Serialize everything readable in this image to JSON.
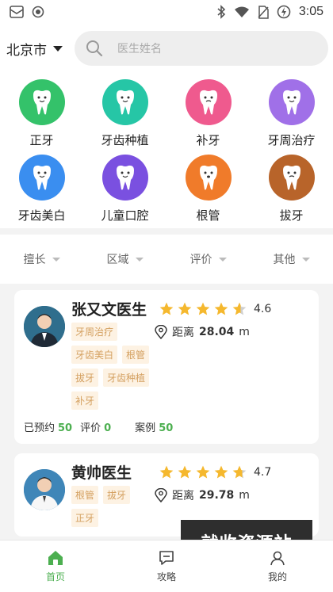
{
  "status_bar": {
    "time": "3:05"
  },
  "header": {
    "city": "北京市",
    "search_placeholder": "医生姓名"
  },
  "categories": [
    {
      "label": "正牙",
      "color": "#34c26a"
    },
    {
      "label": "牙齿种植",
      "color": "#26c6a6"
    },
    {
      "label": "补牙",
      "color": "#ef5a8e"
    },
    {
      "label": "牙周治疗",
      "color": "#a070e8"
    },
    {
      "label": "牙齿美白",
      "color": "#3a8ef0"
    },
    {
      "label": "儿童口腔",
      "color": "#7a50e0"
    },
    {
      "label": "根管",
      "color": "#f07b2a"
    },
    {
      "label": "拔牙",
      "color": "#b8642a"
    }
  ],
  "filters": [
    {
      "label": "擅长"
    },
    {
      "label": "区域"
    },
    {
      "label": "评价"
    },
    {
      "label": "其他"
    }
  ],
  "doctors": [
    {
      "name": "张又文医生",
      "rating": "4.6",
      "rating_value": 4.6,
      "distance_prefix": "距离",
      "distance": "28.04",
      "distance_unit": "m",
      "tags": [
        "牙周治疗",
        "牙齿美白",
        "根管",
        "拔牙",
        "牙齿种植",
        "补牙"
      ],
      "stats": [
        {
          "label": "已预约",
          "value": "50"
        },
        {
          "label": "评价",
          "value": "0"
        },
        {
          "label": "案例",
          "value": "50"
        }
      ]
    },
    {
      "name": "黄帅医生",
      "rating": "4.7",
      "rating_value": 4.7,
      "distance_prefix": "距离",
      "distance": "29.78",
      "distance_unit": "m",
      "tags": [
        "根管",
        "拔牙",
        "正牙"
      ]
    }
  ],
  "watermark": "就收资源站",
  "bottom_nav": [
    {
      "label": "首页",
      "icon": "home-icon",
      "active": true
    },
    {
      "label": "攻略",
      "icon": "chat-icon",
      "active": false
    },
    {
      "label": "我的",
      "icon": "user-icon",
      "active": false
    }
  ],
  "colors": {
    "accent": "#4caf50",
    "star": "#f5b82e",
    "tag_bg": "#fdf2e3",
    "tag_text": "#d4a060"
  }
}
